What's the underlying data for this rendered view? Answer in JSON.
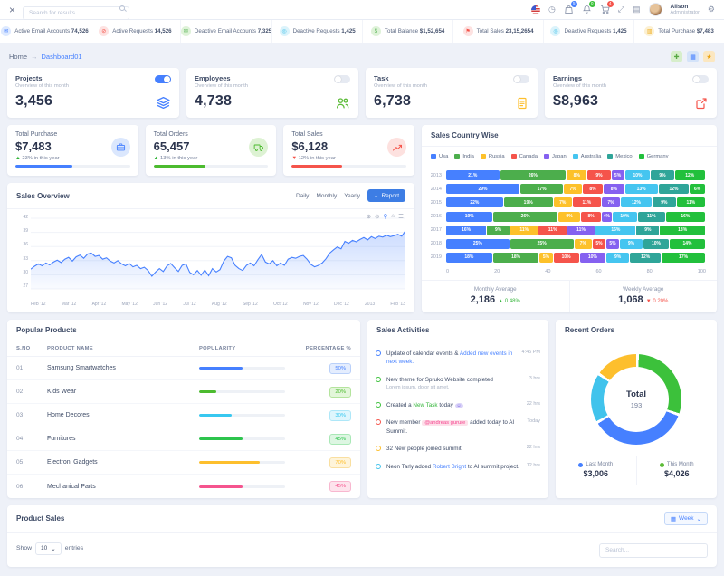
{
  "header": {
    "search_placeholder": "Search for results...",
    "user_name": "Alison",
    "user_role": "Administrator",
    "badges": {
      "messages": "5",
      "notifications": "0",
      "cart": "4"
    }
  },
  "ticker": {
    "items": [
      {
        "label": "Active Email Accounts",
        "value": "74,526",
        "icon": "envelope-icon",
        "glyph": "✉",
        "color": "#4680ff",
        "bg": "#dde9ff"
      },
      {
        "label": "Active Requests",
        "value": "14,526",
        "icon": "block-icon",
        "glyph": "⊘",
        "color": "#f5544b",
        "bg": "#fde2e1"
      },
      {
        "label": "Deactive Email Accounts",
        "value": "7,325",
        "icon": "envelope-icon",
        "glyph": "✉",
        "color": "#4cae4c",
        "bg": "#def2d8"
      },
      {
        "label": "Deactive Requests",
        "value": "1,425",
        "icon": "circle-icon",
        "glyph": "◎",
        "color": "#38bfe8",
        "bg": "#dbf3fb"
      },
      {
        "label": "Total Balance",
        "value": "$1,52,654",
        "icon": "dollar-icon",
        "glyph": "$",
        "color": "#4cae4c",
        "bg": "#def2d8"
      },
      {
        "label": "Total Sales",
        "value": "23,15,2654",
        "icon": "flag-icon",
        "glyph": "⚑",
        "color": "#f5544b",
        "bg": "#fde2e1"
      },
      {
        "label": "Deactive Requests",
        "value": "1,425",
        "icon": "circle-icon",
        "glyph": "◎",
        "color": "#38bfe8",
        "bg": "#dbf3fb"
      },
      {
        "label": "Total Purchase",
        "value": "$7,483",
        "icon": "grid-icon",
        "glyph": "▥",
        "color": "#efae1f",
        "bg": "#fcf0d2"
      }
    ]
  },
  "breadcrumb": {
    "home": "Home",
    "separator": "→",
    "current": "Dashboard01"
  },
  "stat_cards": [
    {
      "title": "Projects",
      "subtitle": "Overview of this month",
      "value": "3,456",
      "toggle_on": true,
      "icon": "layers-icon",
      "color": "#4680ff"
    },
    {
      "title": "Employees",
      "subtitle": "Overview of this month",
      "value": "4,738",
      "toggle_on": false,
      "icon": "users-icon",
      "color": "#5cbb38"
    },
    {
      "title": "Task",
      "subtitle": "Overview of this month",
      "value": "6,738",
      "toggle_on": false,
      "icon": "file-icon",
      "color": "#fdbf2d"
    },
    {
      "title": "Earnings",
      "subtitle": "Overview of this month",
      "value": "$8,963",
      "toggle_on": false,
      "icon": "external-link-icon",
      "color": "#f5544b"
    }
  ],
  "mini_cards": [
    {
      "title": "Total Purchase",
      "value": "$7,483",
      "delta": "23% in this year",
      "delta_dir": "up",
      "bar_pct": 50,
      "color": "#4680ff",
      "bg": "#dbe7fd",
      "icon": "briefcase-icon"
    },
    {
      "title": "Total Orders",
      "value": "65,457",
      "delta": "13% in this year",
      "delta_dir": "up",
      "bar_pct": 45,
      "color": "#4cbb2f",
      "bg": "#ddf2d3",
      "icon": "truck-icon"
    },
    {
      "title": "Total Sales",
      "value": "$6,128",
      "delta": "12% in this year",
      "delta_dir": "down",
      "bar_pct": 44,
      "color": "#f5544b",
      "bg": "#fde1df",
      "icon": "chart-line-icon"
    }
  ],
  "sales_overview": {
    "title": "Sales Overview",
    "ranges": [
      "Daily",
      "Monthly",
      "Yearly"
    ],
    "report_label": "Report",
    "toolbar_icons": [
      "zoom-in-icon",
      "zoom-out-icon",
      "selection-zoom-icon",
      "home-icon",
      "menu-icon"
    ]
  },
  "country_wise": {
    "title": "Sales Country Wise",
    "monthly_average": {
      "label": "Monthly Average",
      "value": "2,186",
      "delta": "0.48%",
      "dir": "up"
    },
    "weekly_average": {
      "label": "Weekly Average",
      "value": "1,068",
      "delta": "0.20%",
      "dir": "down"
    }
  },
  "popular_products": {
    "title": "Popular Products",
    "headers": [
      "S.NO",
      "PRODUCT NAME",
      "POPULARITY",
      "PERCENTAGE %"
    ],
    "rows": [
      {
        "no": "01",
        "name": "Samsung Smartwatches",
        "pct": 50,
        "pct_label": "50%",
        "color": "#4680ff",
        "badge_bg": "#e4edfe",
        "badge_border": "#b9d0f9"
      },
      {
        "no": "02",
        "name": "Kids Wear",
        "pct": 20,
        "pct_label": "20%",
        "color": "#4cbb2f",
        "badge_bg": "#e3f6da",
        "badge_border": "#b4e49d"
      },
      {
        "no": "03",
        "name": "Home Decores",
        "pct": 38,
        "pct_label": "30%",
        "color": "#38c8f0",
        "badge_bg": "#def6fd",
        "badge_border": "#aee7f8"
      },
      {
        "no": "04",
        "name": "Furnitures",
        "pct": 50,
        "pct_label": "45%",
        "color": "#2dc44d",
        "badge_bg": "#ddf6e2",
        "badge_border": "#a9e8b6"
      },
      {
        "no": "05",
        "name": "Electroni Gadgets",
        "pct": 70,
        "pct_label": "70%",
        "color": "#fdbf2d",
        "badge_bg": "#fef4da",
        "badge_border": "#f9dfa0"
      },
      {
        "no": "06",
        "name": "Mechanical Parts",
        "pct": 50,
        "pct_label": "45%",
        "color": "#f5548e",
        "badge_bg": "#fde3ec",
        "badge_border": "#f8b7cf"
      }
    ]
  },
  "sales_activities": {
    "title": "Sales Activities",
    "items": [
      {
        "dot": "#4680ff",
        "time": "4:45 PM",
        "parts": [
          {
            "t": "Update of calendar events & ",
            "s": "plain"
          },
          {
            "t": "Added new events in next week.",
            "s": "blue"
          }
        ]
      },
      {
        "dot": "#3cc13b",
        "time": "3 hrs",
        "parts": [
          {
            "t": "New theme for Spruko Website completed",
            "s": "plain"
          }
        ],
        "sub": "Lorem ipsum, dolor sit amet."
      },
      {
        "dot": "#3cc13b",
        "time": "22 hrs",
        "parts": [
          {
            "t": "Created a ",
            "s": "plain"
          },
          {
            "t": "New Task",
            "s": "green"
          },
          {
            "t": " today ",
            "s": "plain"
          },
          {
            "t": "☺",
            "s": "chip"
          }
        ]
      },
      {
        "dot": "#f5544b",
        "time": "Today",
        "parts": [
          {
            "t": "New member ",
            "s": "plain"
          },
          {
            "t": "@andreas gurure",
            "s": "pill"
          },
          {
            "t": " added today to AI Summit.",
            "s": "plain"
          }
        ]
      },
      {
        "dot": "#fdbf2d",
        "time": "22 hrs",
        "parts": [
          {
            "t": "32 New people joined summit.",
            "s": "plain"
          }
        ]
      },
      {
        "dot": "#41c3ec",
        "time": "12 hrs",
        "parts": [
          {
            "t": "Neon Tarly added ",
            "s": "plain"
          },
          {
            "t": "Robert Bright",
            "s": "blue"
          },
          {
            "t": " to AI summit project.",
            "s": "plain"
          }
        ]
      }
    ]
  },
  "recent_orders": {
    "title": "Recent Orders",
    "total_label": "Total",
    "total_value": "193",
    "legend": [
      {
        "label": "Last Month",
        "value": "$3,006",
        "color": "#4680ff"
      },
      {
        "label": "This Month",
        "value": "$4,026",
        "color": "#5cbb38"
      }
    ]
  },
  "product_sales": {
    "title": "Product Sales",
    "week_label": "Week",
    "show_label": "Show",
    "entries_label": "entries",
    "page_size": "10",
    "search_placeholder": "Search..."
  },
  "chart_data": [
    {
      "type": "area",
      "title": "Sales Overview",
      "x_labels": [
        "Feb '12",
        "Mar '12",
        "Apr '12",
        "May '12",
        "Jun '12",
        "Jul '12",
        "Aug '12",
        "Sep '12",
        "Oct '12",
        "Nov '12",
        "Dec '12",
        "2013",
        "Feb '13"
      ],
      "y_ticks": [
        42,
        39,
        36,
        33,
        30,
        27
      ],
      "ylim": [
        27,
        42
      ],
      "line_color": "#4680ff",
      "values": [
        31.2,
        31.8,
        32.3,
        31.9,
        32.5,
        32.1,
        32.7,
        33.1,
        32.6,
        33.3,
        33.7,
        32.9,
        33.8,
        34.2,
        33.5,
        34.4,
        34.6,
        33.9,
        34.1,
        33.3,
        33.6,
        32.9,
        32.5,
        33.0,
        32.3,
        31.9,
        32.4,
        31.7,
        32.0,
        31.3,
        31.6,
        30.9,
        29.7,
        30.6,
        31.3,
        30.7,
        31.9,
        32.4,
        31.5,
        30.7,
        32.0,
        32.3,
        30.5,
        30.0,
        30.9,
        29.9,
        31.0,
        29.8,
        31.3,
        30.6,
        31.1,
        32.9,
        33.9,
        33.6,
        32.0,
        31.3,
        30.9,
        32.0,
        32.5,
        31.9,
        33.2,
        34.3,
        32.7,
        32.3,
        33.0,
        31.9,
        32.5,
        32.0,
        33.3,
        33.7,
        33.5,
        33.9,
        34.1,
        33.3,
        32.2,
        31.7,
        32.0,
        32.5,
        33.4,
        34.6,
        35.3,
        35.9,
        35.5,
        37.1,
        36.7,
        37.3,
        37.0,
        37.5,
        37.9,
        37.4,
        38.1,
        37.7,
        38.2,
        38.0,
        38.4,
        38.1,
        38.3,
        38.6,
        38.2,
        39.3
      ]
    },
    {
      "type": "bar",
      "stacked": true,
      "orientation": "horizontal",
      "title": "Sales Country Wise",
      "categories": [
        "2013",
        "2014",
        "2015",
        "2016",
        "2017",
        "2018",
        "2019"
      ],
      "x_ticks": [
        0,
        20,
        40,
        60,
        80,
        100
      ],
      "series": [
        {
          "name": "Usa",
          "color": "#4680ff",
          "values": [
            21,
            29,
            22,
            19,
            16,
            25,
            18
          ]
        },
        {
          "name": "India",
          "color": "#4cae4c",
          "values": [
            26,
            17,
            19,
            26,
            9,
            25,
            18
          ]
        },
        {
          "name": "Russia",
          "color": "#fdc12a",
          "values": [
            8,
            7,
            7,
            9,
            11,
            7,
            5
          ]
        },
        {
          "name": "Canada",
          "color": "#f5544b",
          "values": [
            9,
            8,
            11,
            8,
            11,
            5,
            10
          ]
        },
        {
          "name": "Japan",
          "color": "#8561f0",
          "values": [
            5,
            8,
            7,
            4,
            11,
            5,
            10
          ]
        },
        {
          "name": "Australia",
          "color": "#45c5f0",
          "values": [
            10,
            13,
            12,
            10,
            16,
            9,
            9
          ]
        },
        {
          "name": "Mexico",
          "color": "#2fa599",
          "values": [
            9,
            12,
            9,
            11,
            9,
            10,
            12
          ]
        },
        {
          "name": "Germany",
          "color": "#22c03c",
          "values": [
            12,
            6,
            11,
            16,
            18,
            14,
            17
          ]
        }
      ]
    },
    {
      "type": "pie",
      "donut": true,
      "title": "Recent Orders",
      "center_label": "Total",
      "center_value": 193,
      "segments": [
        {
          "label": "This Month",
          "value": 30,
          "color": "#3cc13b"
        },
        {
          "label": "Last Month",
          "value": 36,
          "color": "#4680ff"
        },
        {
          "label": "",
          "value": 18,
          "color": "#41c3ec"
        },
        {
          "label": "",
          "value": 16,
          "color": "#fdbf2d"
        }
      ]
    }
  ]
}
